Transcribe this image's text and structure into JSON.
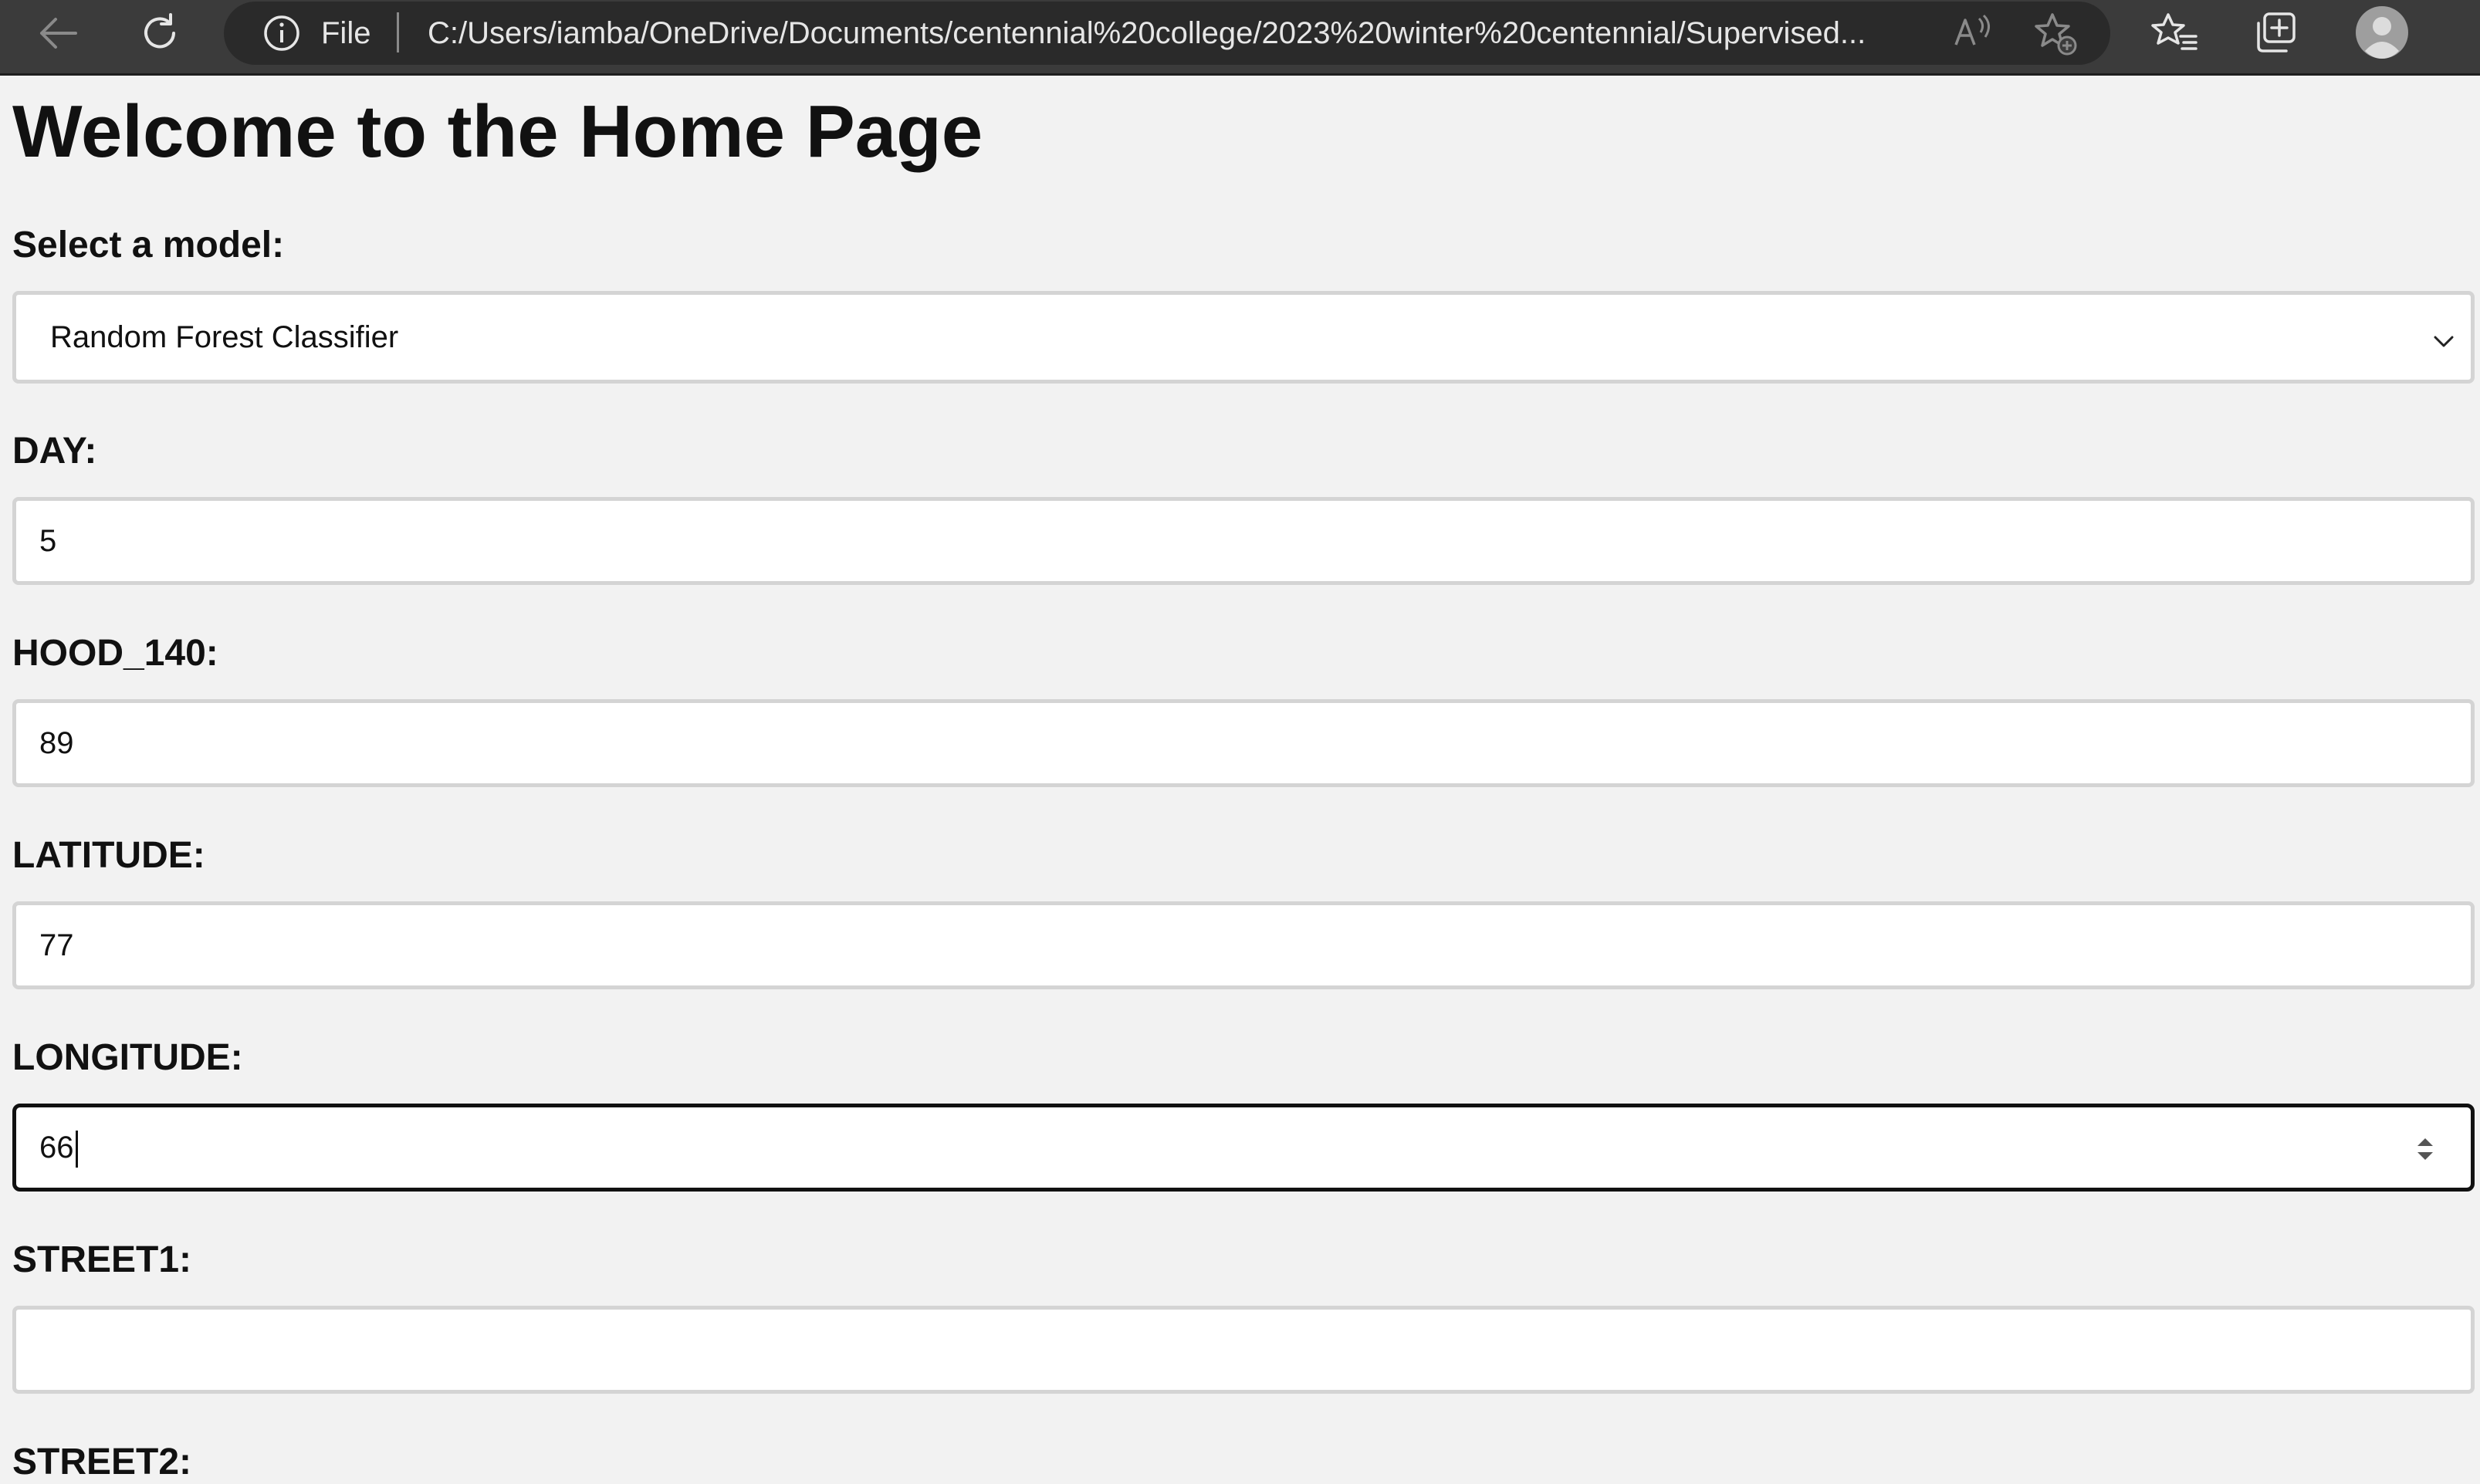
{
  "browser": {
    "address_prefix": "File",
    "url": "C:/Users/iamba/OneDrive/Documents/centennial%20college/2023%20winter%20centennial/Supervised..."
  },
  "page": {
    "heading": "Welcome to the Home Page",
    "model_label": "Select a model:",
    "model_selected": "Random Forest Classifier",
    "fields": {
      "day": {
        "label": "DAY:",
        "value": "5"
      },
      "hood": {
        "label": "HOOD_140:",
        "value": "89"
      },
      "latitude": {
        "label": "LATITUDE:",
        "value": "77"
      },
      "longitude": {
        "label": "LONGITUDE:",
        "value": "66"
      },
      "street1": {
        "label": "STREET1:",
        "value": ""
      },
      "street2": {
        "label": "STREET2:"
      }
    }
  },
  "icons": {
    "back": "back-arrow-icon",
    "refresh": "refresh-icon",
    "info": "info-icon",
    "read_aloud": "read-aloud-icon",
    "add_favorite": "add-favorite-icon",
    "favorites": "favorites-icon",
    "collections": "collections-icon",
    "profile": "profile-icon"
  },
  "colors": {
    "toolbar_bg": "#3b3b3b",
    "page_bg": "#f2f2f2",
    "focus_border": "#111111"
  }
}
